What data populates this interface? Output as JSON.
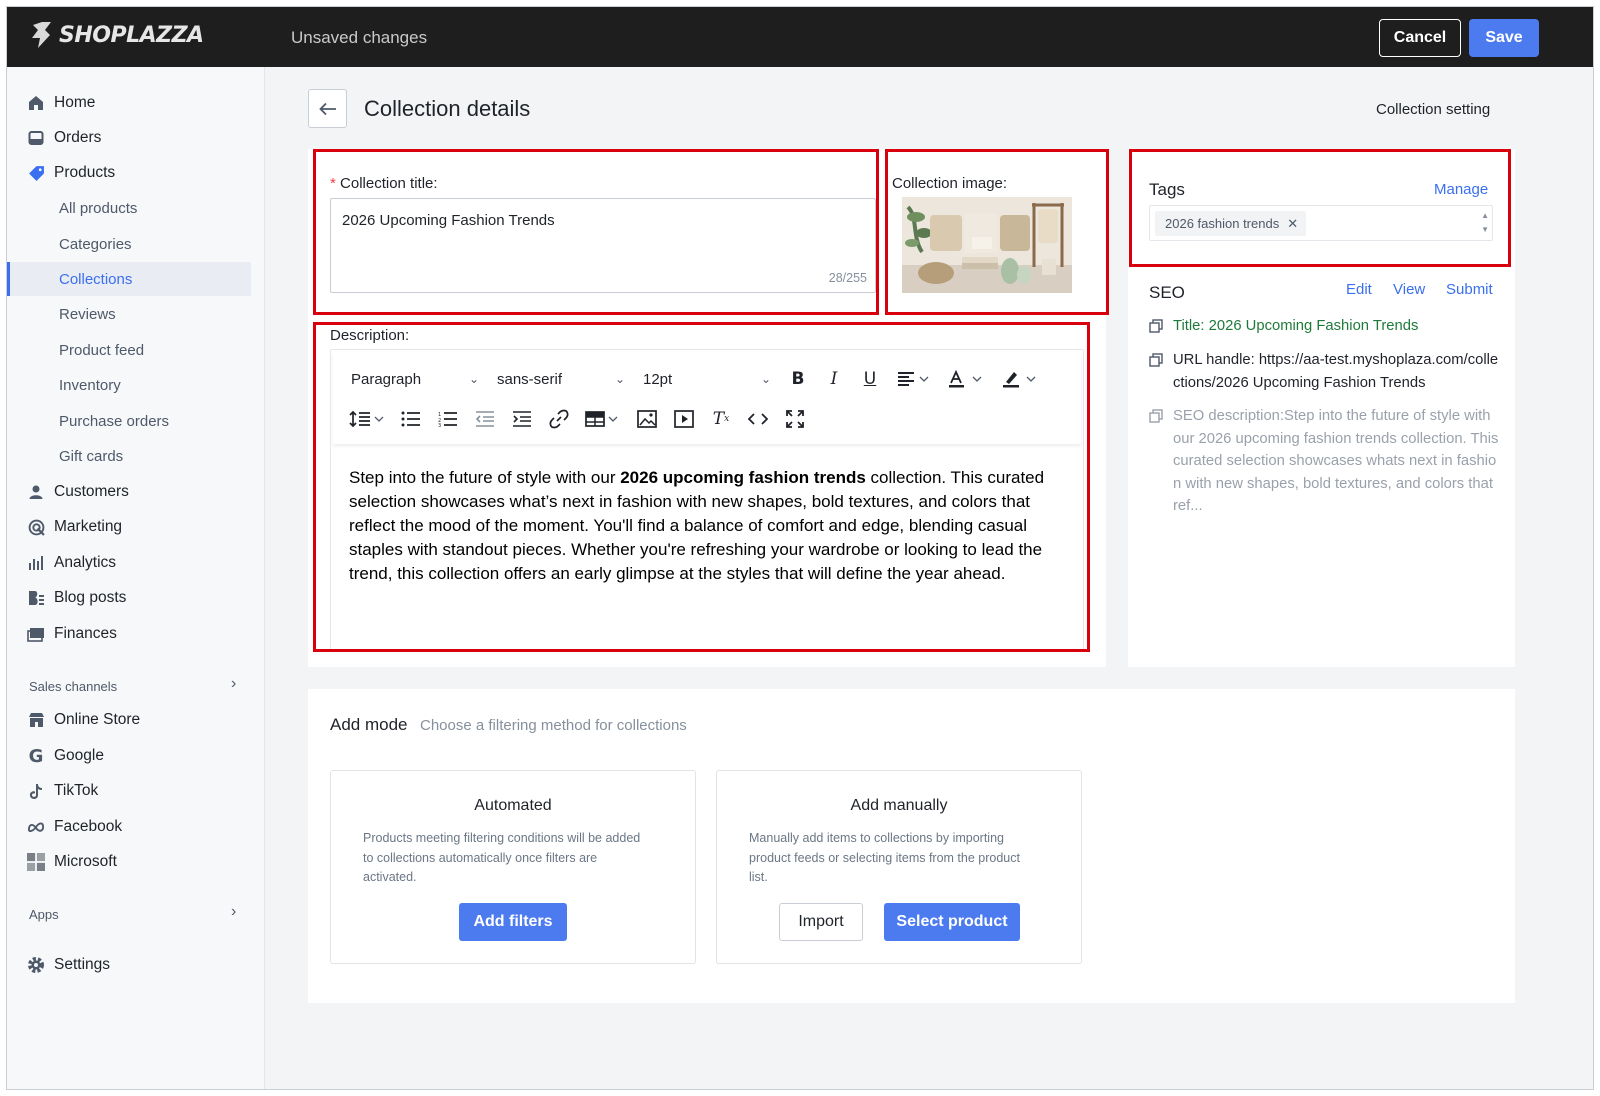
{
  "topbar": {
    "brand": "SHOPLAZZA",
    "status": "Unsaved changes",
    "cancel_label": "Cancel",
    "save_label": "Save"
  },
  "sidebar": {
    "items": [
      {
        "label": "Home",
        "icon": "home-icon"
      },
      {
        "label": "Orders",
        "icon": "orders-icon"
      },
      {
        "label": "Products",
        "icon": "tag-icon"
      },
      {
        "label": "All products"
      },
      {
        "label": "Categories"
      },
      {
        "label": "Collections"
      },
      {
        "label": "Reviews"
      },
      {
        "label": "Product feed"
      },
      {
        "label": "Inventory"
      },
      {
        "label": "Purchase orders"
      },
      {
        "label": "Gift cards"
      },
      {
        "label": "Customers",
        "icon": "person-icon"
      },
      {
        "label": "Marketing",
        "icon": "marketing-icon"
      },
      {
        "label": "Analytics",
        "icon": "bar-chart-icon"
      },
      {
        "label": "Blog posts",
        "icon": "blog-icon"
      },
      {
        "label": "Finances",
        "icon": "finances-icon"
      }
    ],
    "sales_channels_label": "Sales channels",
    "channels": [
      {
        "label": "Online Store",
        "icon": "store-icon"
      },
      {
        "label": "Google",
        "icon": "google-icon"
      },
      {
        "label": "TikTok",
        "icon": "tiktok-icon"
      },
      {
        "label": "Facebook",
        "icon": "meta-icon"
      },
      {
        "label": "Microsoft",
        "icon": "microsoft-icon"
      }
    ],
    "apps_label": "Apps",
    "settings_label": "Settings"
  },
  "page": {
    "title": "Collection details",
    "setting_link": "Collection setting"
  },
  "collection_title": {
    "label": "Collection title",
    "colon": ":",
    "value": "2026 Upcoming Fashion Trends",
    "counter": "28/255"
  },
  "collection_image": {
    "label": "Collection image",
    "colon": ":"
  },
  "description": {
    "label": "Description:",
    "toolbar": {
      "block": "Paragraph",
      "font": "sans-serif",
      "size": "12pt"
    },
    "text_before": "Step into the future of style with our ",
    "text_bold": "2026 upcoming fashion trends",
    "text_after": " collection. This curated selection showcases what’s next in fashion with new shapes, bold textures, and colors that reflect the mood of the moment. You'll find a balance of comfort and edge, blending casual staples with standout pieces. Whether you're refreshing your wardrobe or looking to lead the trend, this collection offers an early glimpse at the styles that will define the year ahead."
  },
  "tags": {
    "title": "Tags",
    "manage_label": "Manage",
    "items": [
      "2026 fashion trends"
    ]
  },
  "seo": {
    "title": "SEO",
    "edit_label": "Edit",
    "view_label": "View",
    "submit_label": "Submit",
    "seo_title": "Title: 2026 Upcoming Fashion Trends",
    "url_handle": "URL handle: https://aa-test.myshoplaza.com/collections/2026 Upcoming Fashion Trends",
    "description": "SEO description:Step into the future of style with our 2026 upcoming fashion trends collection. This curated selection showcases whats next in fashion with new shapes, bold textures, and colors that ref..."
  },
  "add_mode": {
    "label": "Add mode",
    "hint": "Choose a filtering method for collections",
    "automated": {
      "title": "Automated",
      "desc": "Products meeting filtering conditions will be added to collections automatically once filters are activated.",
      "button": "Add filters"
    },
    "manual": {
      "title": "Add manually",
      "desc": "Manually add items to collections by importing product feeds or selecting items from the product list.",
      "import_button": "Import",
      "select_button": "Select product"
    }
  },
  "colors": {
    "accent": "#4c7bf0",
    "highlight": "#d9000d",
    "seo_title_green": "#1f7a3a"
  }
}
